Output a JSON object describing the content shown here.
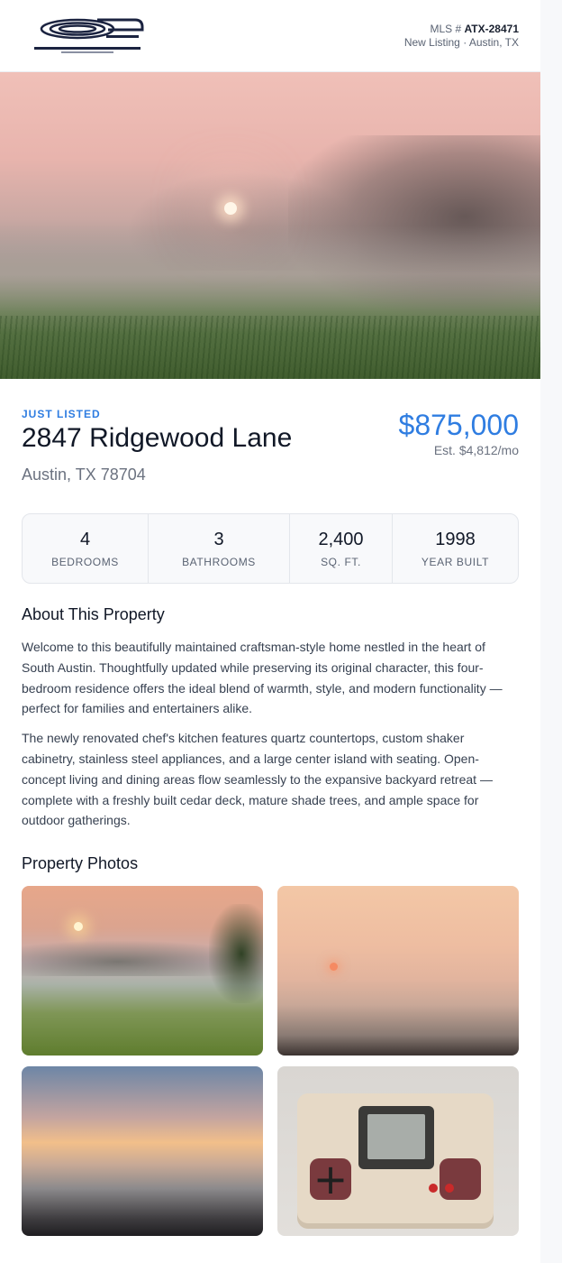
{
  "header": {
    "mls_prefix": "MLS #",
    "mls_number": "ATX-28471",
    "subline": "New Listing · Austin, TX"
  },
  "listing": {
    "tag": "JUST LISTED",
    "address": "2847 Ridgewood Lane",
    "city_line": "Austin, TX 78704",
    "price": "$875,000",
    "monthly": "Est. $4,812/mo"
  },
  "stats": [
    {
      "value": "4",
      "label": "BEDROOMS"
    },
    {
      "value": "3",
      "label": "BATHROOMS"
    },
    {
      "value": "2,400",
      "label": "SQ. FT."
    },
    {
      "value": "1998",
      "label": "YEAR BUILT"
    }
  ],
  "about": {
    "heading": "About This Property",
    "paragraphs": [
      "Welcome to this beautifully maintained craftsman-style home nestled in the heart of South Austin. Thoughtfully updated while preserving its original character, this four-bedroom residence offers the ideal blend of warmth, style, and modern functionality — perfect for families and entertainers alike.",
      "The newly renovated chef's kitchen features quartz countertops, custom shaker cabinetry, stainless steel appliances, and a large center island with seating. Open-concept living and dining areas flow seamlessly to the expansive backyard retreat — complete with a freshly built cedar deck, mature shade trees, and ample space for outdoor gatherings."
    ]
  },
  "photos": {
    "heading": "Property Photos"
  },
  "colors": {
    "accent": "#2f7de1",
    "text": "#111827",
    "muted": "#6b7280",
    "border": "#e3e6eb"
  }
}
